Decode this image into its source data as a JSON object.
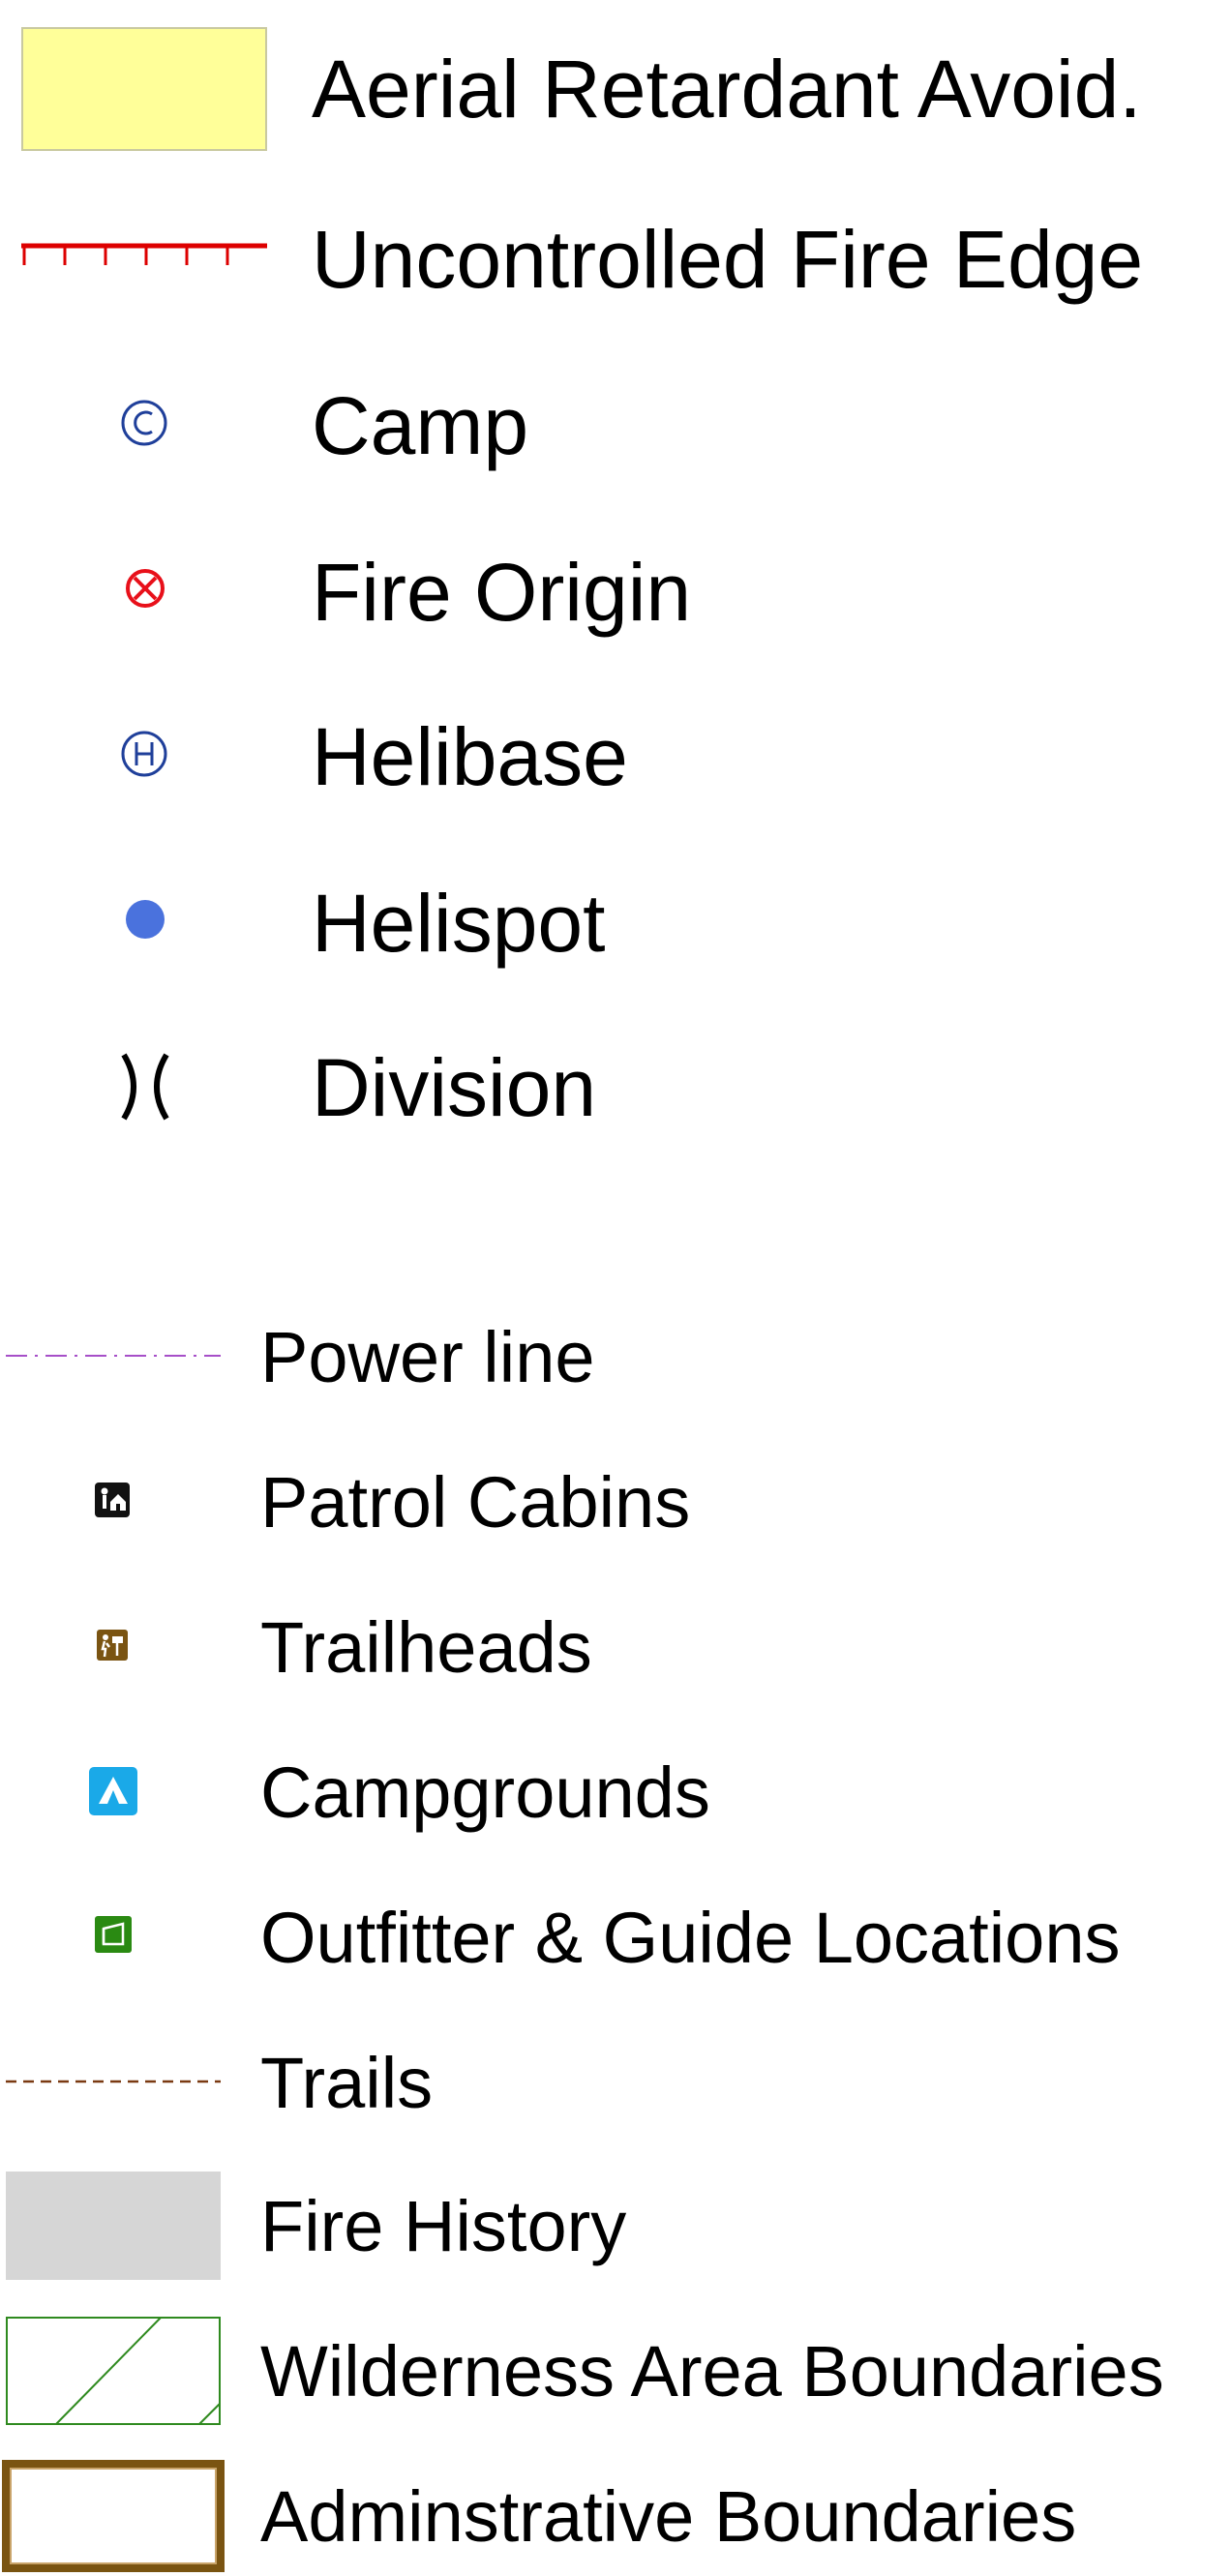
{
  "legend": {
    "incident_items": [
      {
        "label": "Aerial Retardant Avoid.",
        "symbol": "yellow-area-swatch",
        "color": "#ffff99"
      },
      {
        "label": "Uncontrolled Fire Edge",
        "symbol": "ticked-red-line",
        "color": "#dd0000"
      },
      {
        "label": "Camp",
        "symbol": "circled-c-glyph",
        "glyph": "©",
        "color": "#1f3f9a"
      },
      {
        "label": "Fire Origin",
        "symbol": "circled-x-glyph",
        "glyph": "⊗",
        "color": "#e8101a"
      },
      {
        "label": "Helibase",
        "symbol": "circled-h-glyph",
        "glyph": "Ⓗ",
        "color": "#1f3f9a"
      },
      {
        "label": "Helispot",
        "symbol": "filled-blue-dot",
        "color": "#4a72dd"
      },
      {
        "label": "Division",
        "symbol": "division-brackets",
        "glyph": ")(",
        "color": "#000000"
      }
    ],
    "basemap_items": [
      {
        "label": "Power line",
        "symbol": "dash-dot-line",
        "color": "#a64fc8"
      },
      {
        "label": "Patrol Cabins",
        "symbol": "cabin-icon",
        "color": "#111111"
      },
      {
        "label": "Trailheads",
        "symbol": "trailhead-icon",
        "color": "#7a5412"
      },
      {
        "label": "Campgrounds",
        "symbol": "tent-icon",
        "color": "#1aa9e8"
      },
      {
        "label": "Outfitter & Guide Locations",
        "symbol": "outfitter-icon",
        "color": "#2a8a12"
      },
      {
        "label": "Trails",
        "symbol": "dashed-brown-line",
        "color": "#7a3a12"
      },
      {
        "label": "Fire History",
        "symbol": "gray-area-swatch",
        "color": "#d6d6d6"
      },
      {
        "label": "Wilderness Area Boundaries",
        "symbol": "hatched-green-outline",
        "color": "#2f8a1f"
      },
      {
        "label": "Adminstrative Boundaries",
        "symbol": "brown-double-outline",
        "color": "#7a5412"
      }
    ]
  }
}
